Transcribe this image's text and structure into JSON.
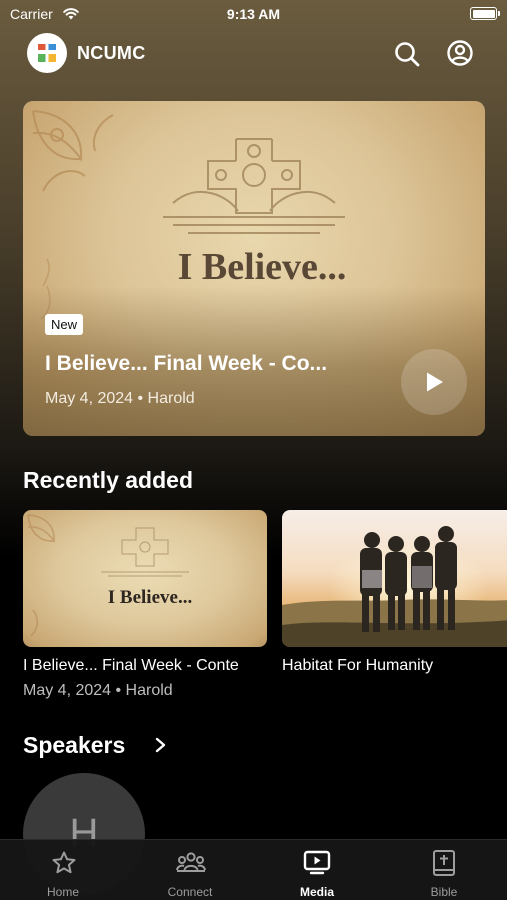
{
  "status_bar": {
    "carrier": "Carrier",
    "time": "9:13 AM"
  },
  "header": {
    "app_name": "NCUMC"
  },
  "featured": {
    "badge": "New",
    "artwork_title": "I Believe...",
    "title": "I Believe... Final Week - Co...",
    "meta": "May 4, 2024 • Harold"
  },
  "recently_added": {
    "title": "Recently added",
    "items": [
      {
        "artwork_title": "I Believe...",
        "title": "I Believe... Final Week - Conte",
        "meta": "May 4, 2024 • Harold"
      },
      {
        "title": "Habitat For Humanity"
      }
    ]
  },
  "speakers": {
    "title": "Speakers",
    "items": [
      {
        "initial": "H"
      }
    ]
  },
  "tabs": [
    {
      "label": "Home",
      "icon": "star-icon"
    },
    {
      "label": "Connect",
      "icon": "people-icon"
    },
    {
      "label": "Media",
      "icon": "media-icon",
      "active": true
    },
    {
      "label": "Bible",
      "icon": "bible-icon"
    }
  ]
}
